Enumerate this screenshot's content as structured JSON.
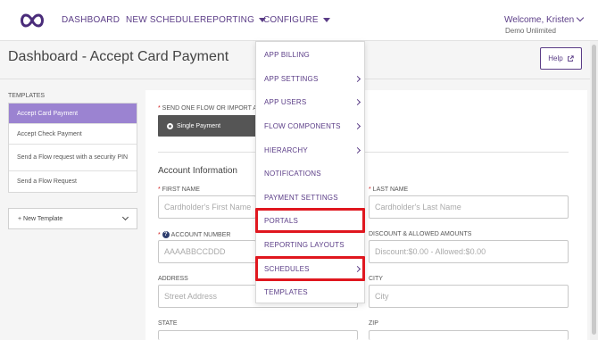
{
  "header": {
    "nav": [
      "DASHBOARD",
      "NEW SCHEDULE",
      "REPORTING",
      "CONFIGURE"
    ],
    "welcome": "Welcome, Kristen",
    "org": "Demo Unlimited"
  },
  "page": {
    "title": "Dashboard - Accept Card Payment",
    "help_label": "Help"
  },
  "sidebar": {
    "templates_label": "TEMPLATES",
    "items": [
      {
        "label": "Accept Card Payment",
        "active": true
      },
      {
        "label": "Accept Check Payment",
        "active": false
      },
      {
        "label": "Send a Flow request with a security PIN",
        "active": false
      },
      {
        "label": "Send a Flow Request",
        "active": false
      }
    ],
    "new_template_label": "+ New Template"
  },
  "form": {
    "flow_label": "SEND ONE FLOW OR IMPORT A",
    "single_payment_label": "Single Payment",
    "section_title": "Account Information",
    "first_name": {
      "label": "FIRST NAME",
      "placeholder": "Cardholder's First Name"
    },
    "last_name": {
      "label": "LAST NAME",
      "placeholder": "Cardholder's Last Name"
    },
    "account_number": {
      "label": "ACCOUNT NUMBER",
      "placeholder": "AAAABBCCDDD"
    },
    "discount": {
      "label": "DISCOUNT & ALLOWED AMOUNTS",
      "placeholder": "Discount:$0.00 - Allowed:$0.00"
    },
    "address": {
      "label": "ADDRESS",
      "placeholder": "Street Address"
    },
    "city": {
      "label": "CITY",
      "placeholder": "City"
    },
    "state": {
      "label": "STATE"
    },
    "zip": {
      "label": "ZIP"
    }
  },
  "configure_menu": {
    "items": [
      {
        "label": "APP BILLING",
        "submenu": false,
        "highlighted": false
      },
      {
        "label": "APP SETTINGS",
        "submenu": true,
        "highlighted": false
      },
      {
        "label": "APP USERS",
        "submenu": true,
        "highlighted": false
      },
      {
        "label": "FLOW COMPONENTS",
        "submenu": true,
        "highlighted": false
      },
      {
        "label": "HIERARCHY",
        "submenu": true,
        "highlighted": false
      },
      {
        "label": "NOTIFICATIONS",
        "submenu": false,
        "highlighted": false
      },
      {
        "label": "PAYMENT SETTINGS",
        "submenu": false,
        "highlighted": false
      },
      {
        "label": "PORTALS",
        "submenu": false,
        "highlighted": true
      },
      {
        "label": "REPORTING LAYOUTS",
        "submenu": false,
        "highlighted": false
      },
      {
        "label": "SCHEDULES",
        "submenu": true,
        "highlighted": true
      },
      {
        "label": "TEMPLATES",
        "submenu": false,
        "highlighted": false
      }
    ]
  },
  "colors": {
    "brand": "#5b3d87",
    "active_template": "#9b83d1",
    "highlight_box": "#e0171f",
    "required": "#d02020"
  }
}
